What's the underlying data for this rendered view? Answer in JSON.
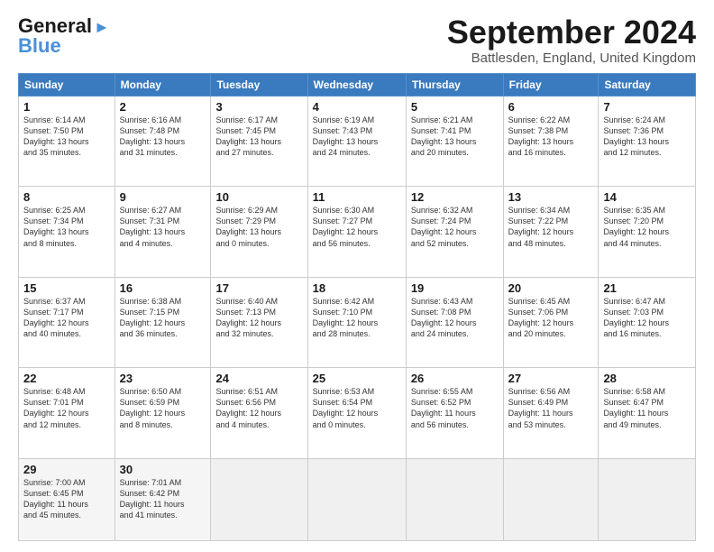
{
  "header": {
    "logo_line1": "General",
    "logo_line2": "Blue",
    "title": "September 2024",
    "location": "Battlesden, England, United Kingdom"
  },
  "weekdays": [
    "Sunday",
    "Monday",
    "Tuesday",
    "Wednesday",
    "Thursday",
    "Friday",
    "Saturday"
  ],
  "weeks": [
    [
      {
        "day": "1",
        "info": "Sunrise: 6:14 AM\nSunset: 7:50 PM\nDaylight: 13 hours\nand 35 minutes."
      },
      {
        "day": "2",
        "info": "Sunrise: 6:16 AM\nSunset: 7:48 PM\nDaylight: 13 hours\nand 31 minutes."
      },
      {
        "day": "3",
        "info": "Sunrise: 6:17 AM\nSunset: 7:45 PM\nDaylight: 13 hours\nand 27 minutes."
      },
      {
        "day": "4",
        "info": "Sunrise: 6:19 AM\nSunset: 7:43 PM\nDaylight: 13 hours\nand 24 minutes."
      },
      {
        "day": "5",
        "info": "Sunrise: 6:21 AM\nSunset: 7:41 PM\nDaylight: 13 hours\nand 20 minutes."
      },
      {
        "day": "6",
        "info": "Sunrise: 6:22 AM\nSunset: 7:38 PM\nDaylight: 13 hours\nand 16 minutes."
      },
      {
        "day": "7",
        "info": "Sunrise: 6:24 AM\nSunset: 7:36 PM\nDaylight: 13 hours\nand 12 minutes."
      }
    ],
    [
      {
        "day": "8",
        "info": "Sunrise: 6:25 AM\nSunset: 7:34 PM\nDaylight: 13 hours\nand 8 minutes."
      },
      {
        "day": "9",
        "info": "Sunrise: 6:27 AM\nSunset: 7:31 PM\nDaylight: 13 hours\nand 4 minutes."
      },
      {
        "day": "10",
        "info": "Sunrise: 6:29 AM\nSunset: 7:29 PM\nDaylight: 13 hours\nand 0 minutes."
      },
      {
        "day": "11",
        "info": "Sunrise: 6:30 AM\nSunset: 7:27 PM\nDaylight: 12 hours\nand 56 minutes."
      },
      {
        "day": "12",
        "info": "Sunrise: 6:32 AM\nSunset: 7:24 PM\nDaylight: 12 hours\nand 52 minutes."
      },
      {
        "day": "13",
        "info": "Sunrise: 6:34 AM\nSunset: 7:22 PM\nDaylight: 12 hours\nand 48 minutes."
      },
      {
        "day": "14",
        "info": "Sunrise: 6:35 AM\nSunset: 7:20 PM\nDaylight: 12 hours\nand 44 minutes."
      }
    ],
    [
      {
        "day": "15",
        "info": "Sunrise: 6:37 AM\nSunset: 7:17 PM\nDaylight: 12 hours\nand 40 minutes."
      },
      {
        "day": "16",
        "info": "Sunrise: 6:38 AM\nSunset: 7:15 PM\nDaylight: 12 hours\nand 36 minutes."
      },
      {
        "day": "17",
        "info": "Sunrise: 6:40 AM\nSunset: 7:13 PM\nDaylight: 12 hours\nand 32 minutes."
      },
      {
        "day": "18",
        "info": "Sunrise: 6:42 AM\nSunset: 7:10 PM\nDaylight: 12 hours\nand 28 minutes."
      },
      {
        "day": "19",
        "info": "Sunrise: 6:43 AM\nSunset: 7:08 PM\nDaylight: 12 hours\nand 24 minutes."
      },
      {
        "day": "20",
        "info": "Sunrise: 6:45 AM\nSunset: 7:06 PM\nDaylight: 12 hours\nand 20 minutes."
      },
      {
        "day": "21",
        "info": "Sunrise: 6:47 AM\nSunset: 7:03 PM\nDaylight: 12 hours\nand 16 minutes."
      }
    ],
    [
      {
        "day": "22",
        "info": "Sunrise: 6:48 AM\nSunset: 7:01 PM\nDaylight: 12 hours\nand 12 minutes."
      },
      {
        "day": "23",
        "info": "Sunrise: 6:50 AM\nSunset: 6:59 PM\nDaylight: 12 hours\nand 8 minutes."
      },
      {
        "day": "24",
        "info": "Sunrise: 6:51 AM\nSunset: 6:56 PM\nDaylight: 12 hours\nand 4 minutes."
      },
      {
        "day": "25",
        "info": "Sunrise: 6:53 AM\nSunset: 6:54 PM\nDaylight: 12 hours\nand 0 minutes."
      },
      {
        "day": "26",
        "info": "Sunrise: 6:55 AM\nSunset: 6:52 PM\nDaylight: 11 hours\nand 56 minutes."
      },
      {
        "day": "27",
        "info": "Sunrise: 6:56 AM\nSunset: 6:49 PM\nDaylight: 11 hours\nand 53 minutes."
      },
      {
        "day": "28",
        "info": "Sunrise: 6:58 AM\nSunset: 6:47 PM\nDaylight: 11 hours\nand 49 minutes."
      }
    ],
    [
      {
        "day": "29",
        "info": "Sunrise: 7:00 AM\nSunset: 6:45 PM\nDaylight: 11 hours\nand 45 minutes."
      },
      {
        "day": "30",
        "info": "Sunrise: 7:01 AM\nSunset: 6:42 PM\nDaylight: 11 hours\nand 41 minutes."
      },
      {
        "day": "",
        "info": ""
      },
      {
        "day": "",
        "info": ""
      },
      {
        "day": "",
        "info": ""
      },
      {
        "day": "",
        "info": ""
      },
      {
        "day": "",
        "info": ""
      }
    ]
  ]
}
